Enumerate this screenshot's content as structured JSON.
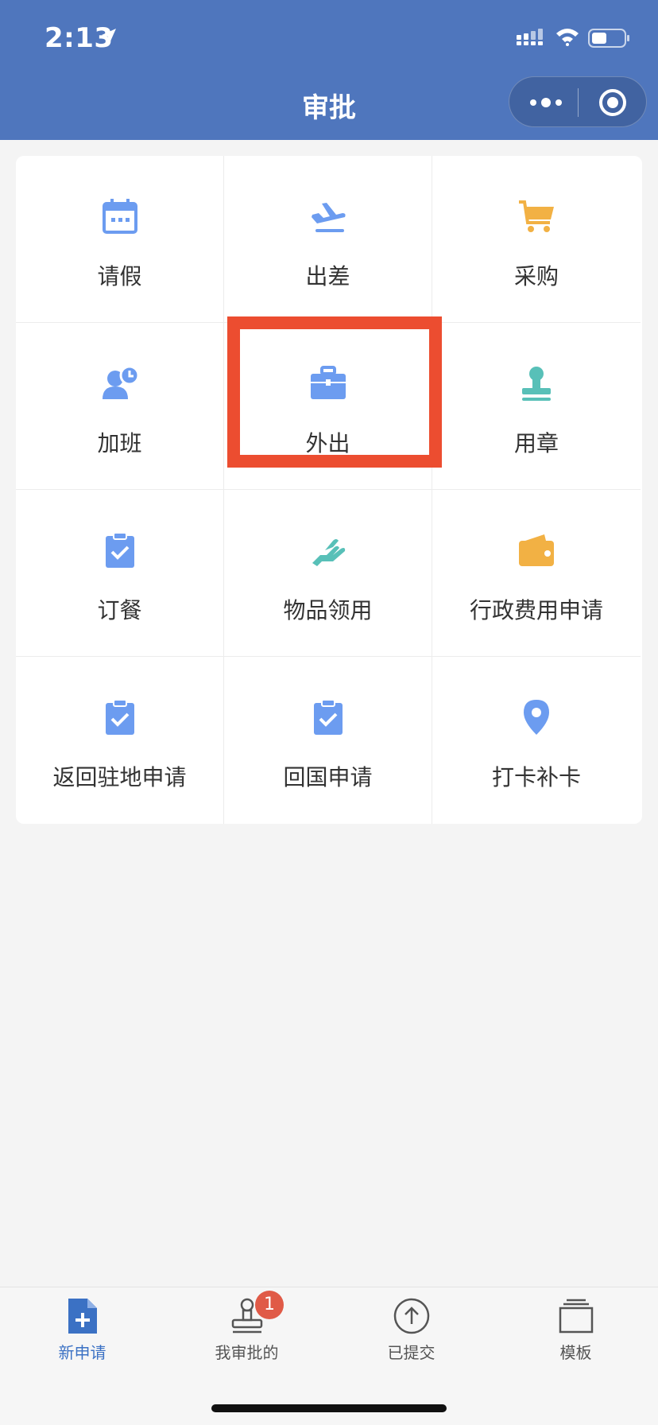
{
  "status_bar": {
    "time": "2:13"
  },
  "header": {
    "title": "审批"
  },
  "grid": [
    {
      "label": "请假",
      "icon": "calendar-icon",
      "color": "#6c9cf0"
    },
    {
      "label": "出差",
      "icon": "plane-icon",
      "color": "#6c9cf0"
    },
    {
      "label": "采购",
      "icon": "cart-icon",
      "color": "#f2b144"
    },
    {
      "label": "加班",
      "icon": "person-clock-icon",
      "color": "#6c9cf0"
    },
    {
      "label": "外出",
      "icon": "briefcase-icon",
      "color": "#6c9cf0"
    },
    {
      "label": "用章",
      "icon": "stamp-icon",
      "color": "#58c0b8"
    },
    {
      "label": "订餐",
      "icon": "clipboard-check-icon",
      "color": "#6c9cf0"
    },
    {
      "label": "物品领用",
      "icon": "hand-icon",
      "color": "#58c0b8"
    },
    {
      "label": "行政费用申请",
      "icon": "wallet-icon",
      "color": "#f2b144"
    },
    {
      "label": "返回驻地申请",
      "icon": "clipboard-check-icon",
      "color": "#6c9cf0"
    },
    {
      "label": "回国申请",
      "icon": "clipboard-check-icon",
      "color": "#6c9cf0"
    },
    {
      "label": "打卡补卡",
      "icon": "location-pin-icon",
      "color": "#6c9cf0"
    }
  ],
  "tabbar": {
    "tabs": [
      {
        "label": "新申请",
        "icon": "new-doc-icon",
        "active": true
      },
      {
        "label": "我审批的",
        "icon": "stamp-outline-icon",
        "badge": "1"
      },
      {
        "label": "已提交",
        "icon": "upload-circle-icon"
      },
      {
        "label": "模板",
        "icon": "template-stack-icon"
      }
    ]
  },
  "colors": {
    "header": "#4f76bd",
    "highlight": "#ec4d30",
    "active_tab": "#3b71c4"
  }
}
